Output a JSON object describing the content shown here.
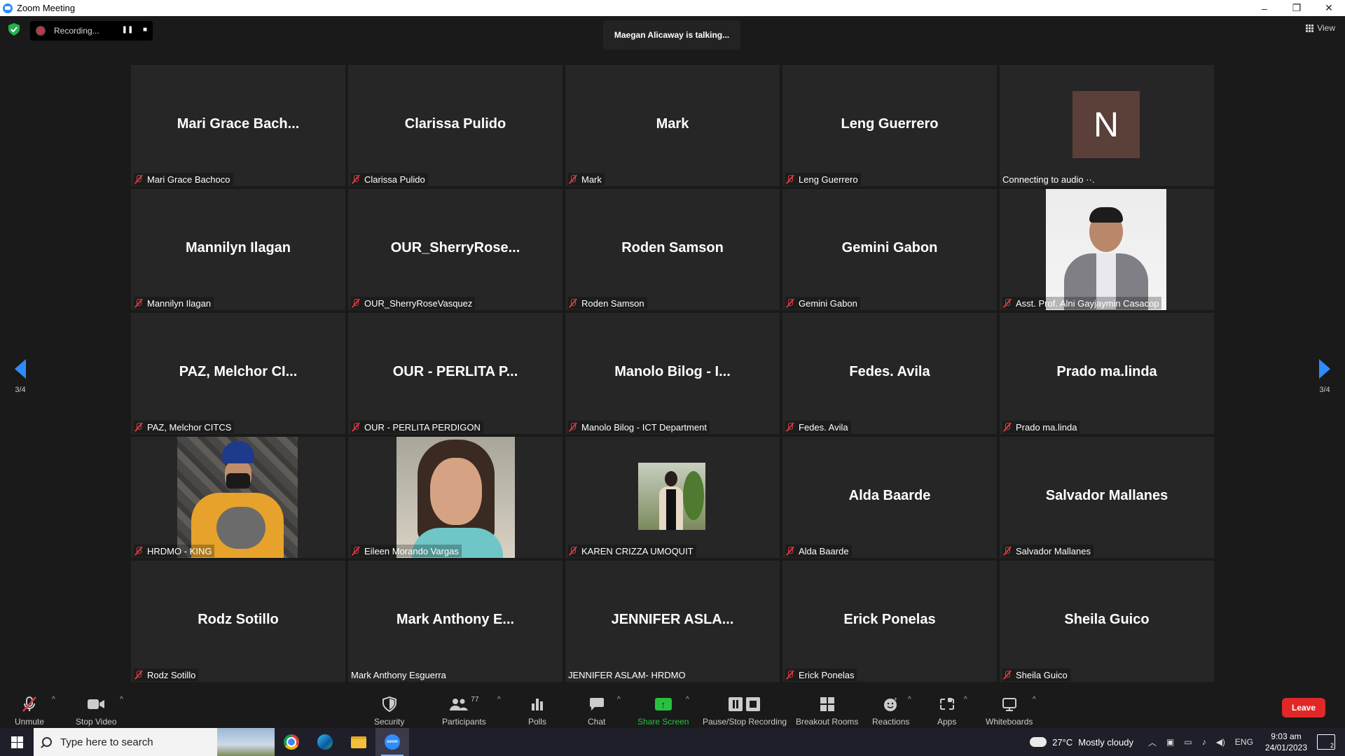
{
  "window": {
    "title": "Zoom Meeting",
    "minimize": "–",
    "restore": "❐",
    "close": "✕"
  },
  "topbar": {
    "recording_label": "Recording...",
    "pause_glyph": "❚❚",
    "stop_glyph": "■",
    "talking": "Maegan Alicaway is talking...",
    "view_label": "View"
  },
  "pager": {
    "left_label": "3/4",
    "right_label": "3/4"
  },
  "participants": [
    {
      "display": "Mari Grace Bach...",
      "label": "Mari Grace Bachoco",
      "muted": true
    },
    {
      "display": "Clarissa Pulido",
      "label": "Clarissa Pulido",
      "muted": true
    },
    {
      "display": "Mark",
      "label": "Mark",
      "muted": true
    },
    {
      "display": "Leng Guerrero",
      "label": "Leng Guerrero",
      "muted": true
    },
    {
      "display": "",
      "avatar_letter": "N",
      "label": "Connecting to audio ··.",
      "muted": false
    },
    {
      "display": "Mannilyn Ilagan",
      "label": "Mannilyn Ilagan",
      "muted": true
    },
    {
      "display": "OUR_SherryRose...",
      "label": "OUR_SherryRoseVasquez",
      "muted": true
    },
    {
      "display": "Roden Samson",
      "label": "Roden Samson",
      "muted": true
    },
    {
      "display": "Gemini Gabon",
      "label": "Gemini Gabon",
      "muted": true
    },
    {
      "display": "",
      "label": "Asst. Prof. Alni Gayjaymin Casacop",
      "muted": true
    },
    {
      "display": "PAZ, Melchor CI...",
      "label": "PAZ, Melchor CITCS",
      "muted": true
    },
    {
      "display": "OUR - PERLITA P...",
      "label": "OUR - PERLITA PERDIGON",
      "muted": true
    },
    {
      "display": "Manolo Bilog - I...",
      "label": "Manolo Bilog - ICT Department",
      "muted": true
    },
    {
      "display": "Fedes. Avila",
      "label": "Fedes. Avila",
      "muted": true
    },
    {
      "display": "Prado ma.linda",
      "label": "Prado ma.linda",
      "muted": true
    },
    {
      "display": "",
      "label": "HRDMO - KING",
      "muted": true
    },
    {
      "display": "",
      "label": "Eileen Morando Vargas",
      "muted": true
    },
    {
      "display": "",
      "label": "KAREN CRIZZA UMOQUIT",
      "muted": true
    },
    {
      "display": "Alda Baarde",
      "label": "Alda Baarde",
      "muted": true
    },
    {
      "display": "Salvador Mallanes",
      "label": "Salvador Mallanes",
      "muted": true
    },
    {
      "display": "Rodz Sotillo",
      "label": "Rodz Sotillo",
      "muted": true
    },
    {
      "display": "Mark Anthony E...",
      "label": "Mark Anthony Esguerra",
      "muted": false
    },
    {
      "display": "JENNIFER  ASLA...",
      "label": "JENNIFER ASLAM- HRDMO",
      "muted": false
    },
    {
      "display": "Erick Ponelas",
      "label": "Erick Ponelas",
      "muted": true
    },
    {
      "display": "Sheila Guico",
      "label": "Sheila Guico",
      "muted": true
    }
  ],
  "toolbar": {
    "unmute": "Unmute",
    "stop_video": "Stop Video",
    "security": "Security",
    "participants": "Participants",
    "participants_count": "77",
    "polls": "Polls",
    "chat": "Chat",
    "share_screen": "Share Screen",
    "pause_stop_recording": "Pause/Stop Recording",
    "breakout_rooms": "Breakout Rooms",
    "reactions": "Reactions",
    "apps": "Apps",
    "whiteboards": "Whiteboards",
    "leave": "Leave",
    "caret": "^",
    "share_arrow": "↑"
  },
  "taskbar": {
    "search_placeholder": "Type here to search",
    "weather_temp": "27°C",
    "weather_text": "Mostly cloudy",
    "language": "ENG",
    "time": "9:03 am",
    "date": "24/01/2023",
    "notifications": "2",
    "zoom_app_text": "zoom"
  },
  "colors": {
    "accent": "#2d8cff",
    "leave": "#e02828",
    "share": "#28c13f",
    "muted": "#e0393e"
  }
}
